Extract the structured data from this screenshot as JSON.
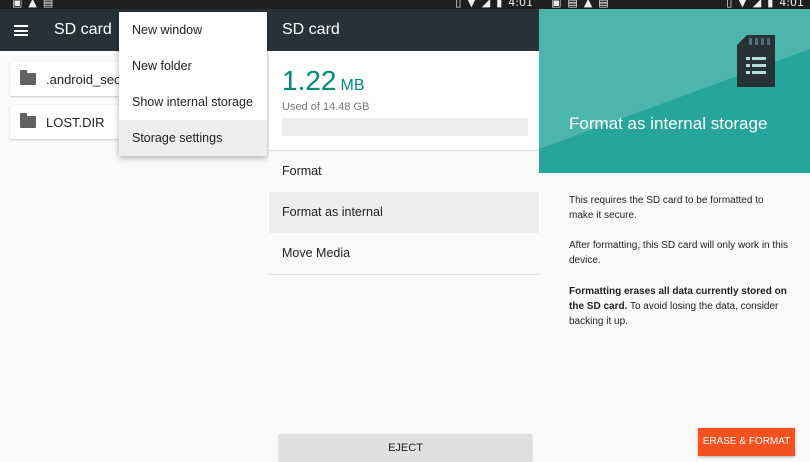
{
  "status_bar": {
    "time": "4:01",
    "icons": [
      "vibrate-icon",
      "wifi-icon",
      "no-signal-icon",
      "battery-icon"
    ],
    "left_icons": [
      "photo-icon",
      "warning-icon",
      "image-icon"
    ]
  },
  "panel1": {
    "title": "SD card",
    "files": [
      {
        "label": ".android_sec…",
        "icon": "folder-icon"
      },
      {
        "label": "LOST.DIR",
        "icon": "folder-icon"
      }
    ],
    "menu": {
      "items": [
        "New window",
        "New folder",
        "Show internal storage",
        "Storage settings"
      ],
      "highlighted": "Storage settings"
    }
  },
  "panel2": {
    "title": "SD card",
    "usage": {
      "amount": "1.22",
      "unit": "MB",
      "subtitle": "Used of 14.48 GB",
      "fraction_used": 0.0001,
      "color": "#00897b"
    },
    "options": [
      "Format",
      "Format as internal",
      "Move Media"
    ],
    "highlighted": "Format as internal",
    "eject_label": "EJECT"
  },
  "panel3": {
    "title": "Format as internal storage",
    "hero_color": "#26a69a",
    "p1": "This requires the SD card to be formatted to make it secure.",
    "p2": "After formatting, this SD card will only work in this device.",
    "p3_bold": "Formatting erases all data currently stored on the SD card.",
    "p3_rest": " To avoid losing the data, consider backing it up.",
    "button_label": "ERASE & FORMAT",
    "button_color": "#f4511e"
  }
}
